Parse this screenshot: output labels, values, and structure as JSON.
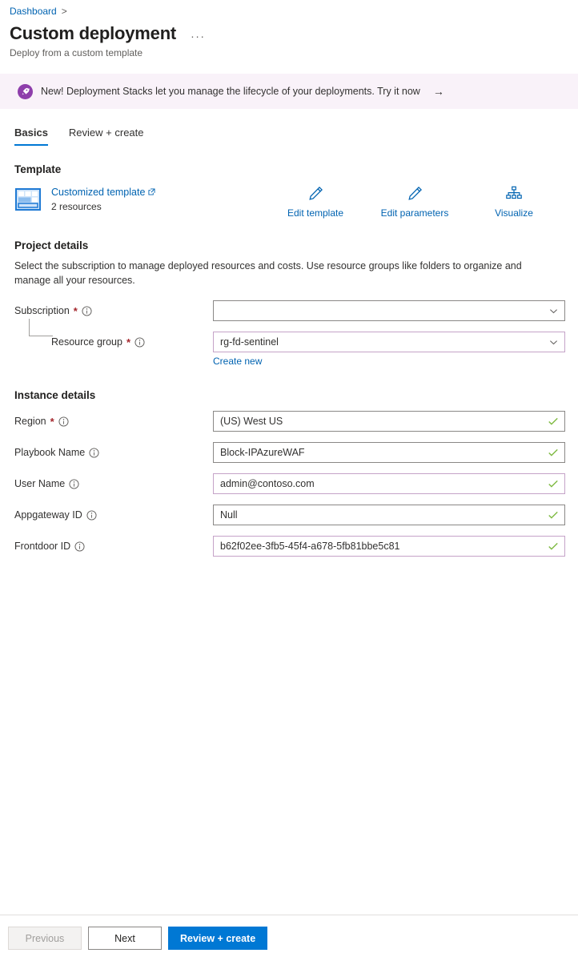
{
  "breadcrumb": {
    "items": [
      {
        "label": "Dashboard",
        "icon": "breadcrumb-link"
      }
    ],
    "separator": ">"
  },
  "header": {
    "title": "Custom deployment",
    "subtitle": "Deploy from a custom template",
    "more_menu": "···"
  },
  "banner": {
    "icon": "rocket-icon",
    "text": "New! Deployment Stacks let you manage the lifecycle of your deployments. Try it now",
    "arrow": "→",
    "background": "#f9f2f9",
    "icon_color": "#8e3eab"
  },
  "tabs": [
    {
      "label": "Basics",
      "active": true
    },
    {
      "label": "Review + create",
      "active": false
    }
  ],
  "template": {
    "heading": "Template",
    "icon": "template-grid-icon",
    "link_label": "Customized template",
    "external_icon": "external-link-icon",
    "resource_count": "2 resources",
    "actions": [
      {
        "label": "Edit template",
        "icon": "pencil-icon"
      },
      {
        "label": "Edit parameters",
        "icon": "pencil-icon"
      },
      {
        "label": "Visualize",
        "icon": "hierarchy-icon"
      }
    ]
  },
  "project_details": {
    "heading": "Project details",
    "description": "Select the subscription to manage deployed resources and costs. Use resource groups like folders to organize and manage all your resources.",
    "fields": [
      {
        "label": "Subscription",
        "required": true,
        "info_icon": "info-icon",
        "value": "",
        "control": "select",
        "border": "gray",
        "chevron": "chevron-down-icon"
      },
      {
        "label": "Resource group",
        "required": true,
        "info_icon": "info-icon",
        "value": "rg-fd-sentinel",
        "control": "select",
        "border": "lilac",
        "chevron": "chevron-down-icon",
        "indent": true,
        "helper_link": "Create new"
      }
    ]
  },
  "instance_details": {
    "heading": "Instance details",
    "fields": [
      {
        "label": "Region",
        "required": true,
        "info_icon": "info-icon",
        "value": "(US) West US",
        "control": "text",
        "border": "gray",
        "valid_icon": "check-icon"
      },
      {
        "label": "Playbook Name",
        "required": false,
        "info_icon": "info-icon",
        "value": "Block-IPAzureWAF",
        "control": "text",
        "border": "gray",
        "valid_icon": "check-icon"
      },
      {
        "label": "User Name",
        "required": false,
        "info_icon": "info-icon",
        "value": "admin@contoso.com",
        "control": "text",
        "border": "lilac",
        "valid_icon": "check-icon"
      },
      {
        "label": "Appgateway ID",
        "required": false,
        "info_icon": "info-icon",
        "value": "Null",
        "control": "text",
        "border": "gray",
        "valid_icon": "check-icon"
      },
      {
        "label": "Frontdoor ID",
        "required": false,
        "info_icon": "info-icon",
        "value": "b62f02ee-3fb5-45f4-a678-5fb81bbe5c81",
        "control": "text",
        "border": "lilac",
        "valid_icon": "check-icon"
      }
    ]
  },
  "footer": {
    "buttons": [
      {
        "label": "Previous",
        "state": "disabled"
      },
      {
        "label": "Next",
        "state": "default"
      },
      {
        "label": "Review + create",
        "state": "primary"
      }
    ]
  },
  "colors": {
    "accent": "#0078d4",
    "link": "#0063b1",
    "required": "#a4262c",
    "valid": "#7fba42",
    "lilac_border": "#c5a3c8"
  }
}
